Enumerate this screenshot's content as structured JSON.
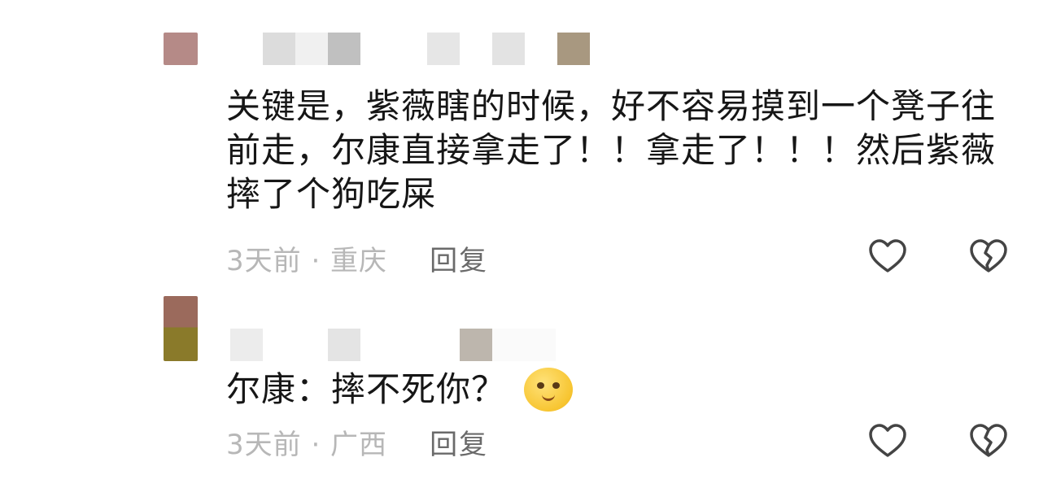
{
  "comments": [
    {
      "content": "关键是，紫薇瞎的时候，好不容易摸到一个凳子往前走，尔康直接拿走了！！拿走了！！！然后紫薇摔了个狗吃屎",
      "time_location": "3天前 · 重庆",
      "reply_label": "回复",
      "avatar_color": "#b58a87",
      "name_mask_colors": [
        "#dcdcdc",
        "#f0f0f0",
        "#c0c0c0",
        "#ffffff",
        "#f4f4f4",
        "#e6e6e6",
        "#ffffff",
        "#e3e3e3",
        "#ffffff",
        "#a89880"
      ]
    },
    {
      "content": "尔康：摔不死你？",
      "time_location": "3天前 · 广西",
      "reply_label": "回复",
      "emoji_icon": "smirk-emoji-icon",
      "name_mask_colors": [
        "#ececec",
        "#ffffff",
        "#ffffff",
        "#e4e4e4",
        "#ffffff",
        "#bdb6ad",
        "#fafafa"
      ]
    }
  ],
  "icons": {
    "like": "heart-outline-icon",
    "dislike": "broken-heart-icon"
  }
}
